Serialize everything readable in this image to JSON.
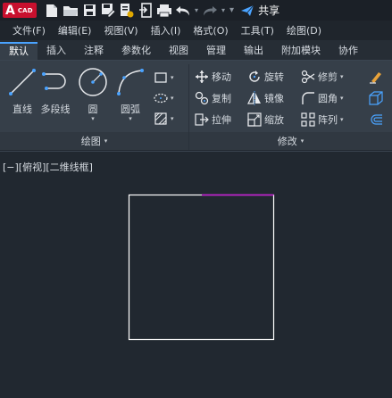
{
  "app": {
    "logo_letter": "A",
    "logo_sub": "CAD"
  },
  "quick_access": {
    "icons": [
      "new-file-icon",
      "open-folder-icon",
      "save-icon",
      "save-as-icon",
      "publish-icon",
      "export-icon",
      "print-icon",
      "undo-icon",
      "redo-icon",
      "dropdown-icon"
    ],
    "share_label": "共享"
  },
  "menu": {
    "items": [
      "文件(F)",
      "编辑(E)",
      "视图(V)",
      "插入(I)",
      "格式(O)",
      "工具(T)",
      "绘图(D)"
    ]
  },
  "tabs": {
    "items": [
      "默认",
      "插入",
      "注释",
      "参数化",
      "视图",
      "管理",
      "输出",
      "附加模块",
      "协作"
    ],
    "active": "默认"
  },
  "draw_panel": {
    "title": "绘图",
    "tools": {
      "line": "直线",
      "polyline": "多段线",
      "circle": "圆",
      "arc": "圆弧"
    },
    "side_icons": [
      "rectangle-icon",
      "ellipse-icon",
      "hatch-icon"
    ]
  },
  "modify_panel": {
    "title": "修改",
    "tools": {
      "move": "移动",
      "rotate": "旋转",
      "trim": "修剪",
      "copy": "复制",
      "mirror": "镜像",
      "fillet": "圆角",
      "stretch": "拉伸",
      "scale": "缩放",
      "array": "阵列"
    },
    "side_icons": [
      "erase-icon",
      "offset-3d-icon",
      "offset-icon"
    ]
  },
  "viewport": {
    "label": "[−][俯视][二维线框]"
  },
  "colors": {
    "accent": "#4aa3ff",
    "logo": "#c8102e",
    "magenta": "#c81ad6",
    "drawing_line": "#ffffff"
  }
}
